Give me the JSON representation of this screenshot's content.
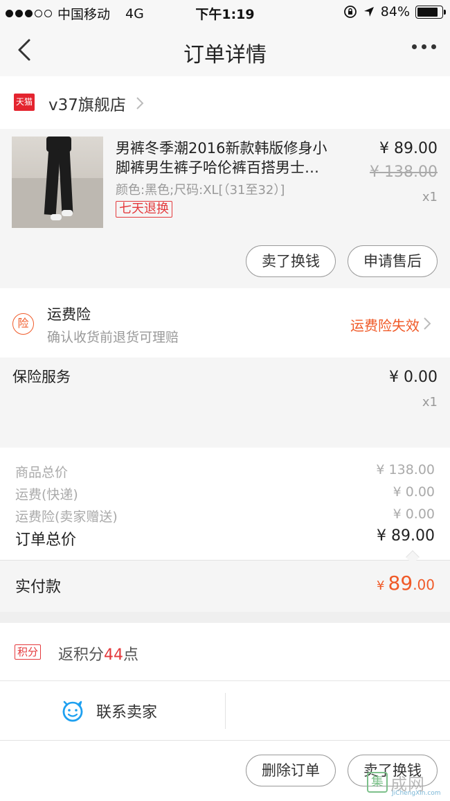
{
  "status_bar": {
    "carrier": "中国移动",
    "network": "4G",
    "time": "下午1:19",
    "battery": "84%",
    "battery_level": 0.84,
    "signal_bars": 3
  },
  "nav": {
    "title": "订单详情"
  },
  "store": {
    "badge": "天猫",
    "name": "v37旗舰店"
  },
  "product": {
    "title_line1": "男裤冬季潮2016新款韩版修身小",
    "title_line2": "脚裤男生裤子哈伦裤百搭男士…",
    "sku": "颜色:黑色;尺码:XL[（31至32）]",
    "tag": "七天退换",
    "price": "¥ 89.00",
    "original_price": "¥ 138.00",
    "quantity": "x1",
    "buttons": {
      "sell": "卖了换钱",
      "after_sales": "申请售后"
    }
  },
  "shipping_insurance": {
    "icon_label": "险",
    "title": "运费险",
    "desc": "确认收货前退货可理赔",
    "status": "运费险失效"
  },
  "service": {
    "title": "保险服务",
    "price": "¥ 0.00",
    "quantity": "x1"
  },
  "summary": {
    "rows": [
      {
        "label": "商品总价",
        "value": "¥ 138.00"
      },
      {
        "label": "运费(快递)",
        "value": "¥ 0.00"
      },
      {
        "label": "运费险(卖家赠送)",
        "value": "¥ 0.00"
      }
    ],
    "total_label": "订单总价",
    "total_value": "¥ 89.00"
  },
  "paid": {
    "label": "实付款",
    "currency": "¥",
    "integer": "89",
    "decimal": ".00"
  },
  "points": {
    "badge": "积分",
    "text_prefix": "返积分",
    "amount": "44",
    "text_suffix": "点"
  },
  "contact": {
    "label": "联系卖家"
  },
  "bottom": {
    "delete": "删除订单",
    "sell": "卖了换钱"
  },
  "watermark": {
    "logo": "集",
    "text": "成网",
    "domain": "JiChengXin.com"
  },
  "colors": {
    "accent": "#f05a28",
    "tmall_red": "#e4242f",
    "tag_red": "#e4393c",
    "contact_blue": "#1ea0f0"
  }
}
